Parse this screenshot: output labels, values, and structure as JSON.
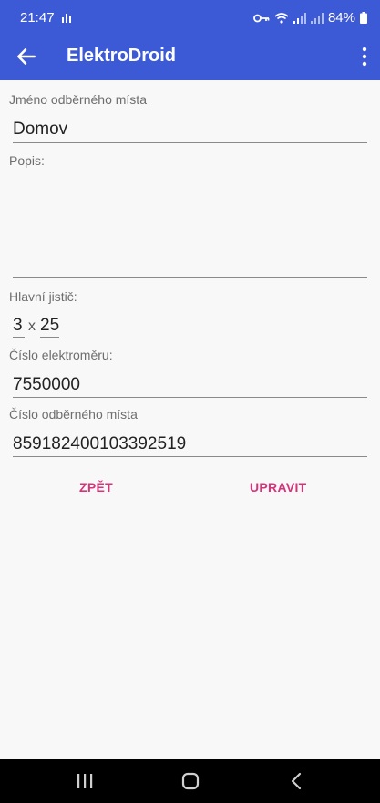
{
  "status": {
    "time": "21:47",
    "battery": "84%"
  },
  "app_bar": {
    "title": "ElektroDroid"
  },
  "form": {
    "name_label": "Jméno odběrného místa",
    "name_value": "Domov",
    "desc_label": "Popis:",
    "desc_value": "",
    "breaker_label": "Hlavní jistič:",
    "breaker_phases": "3",
    "breaker_separator": "x",
    "breaker_amps": "25",
    "meter_label": "Číslo elektroměru:",
    "meter_value": "7550000",
    "place_label": "Číslo odběrného místa",
    "place_value": "859182400103392519"
  },
  "buttons": {
    "back": "ZPĚT",
    "edit": "UPRAVIT"
  },
  "colors": {
    "primary": "#3d5ad6",
    "accent": "#d6337a"
  },
  "icons": [
    "arrow-back-icon",
    "more-vert-icon",
    "key-icon",
    "wifi-icon",
    "signal-icon",
    "battery-icon",
    "recents-icon",
    "home-icon",
    "back-nav-icon"
  ]
}
